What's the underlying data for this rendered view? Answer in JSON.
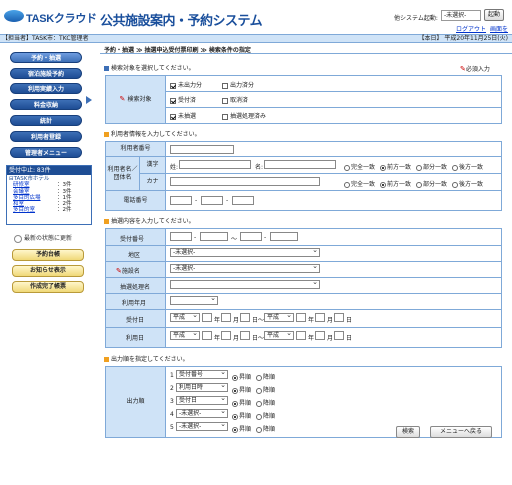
{
  "header": {
    "logo_text": "TASKクラウド",
    "app_title": "公共施設案内・予約システム",
    "system_launch_label": "他システム起動:",
    "system_select_value": "-未選択-",
    "launch_button": "起動",
    "logout_link": "ログアウト",
    "close_link": "画面を閉じる"
  },
  "infobar": {
    "left": "【担当者】TASK市：TKC管理者",
    "right": "【本日】 平成20年11月25日(火)"
  },
  "sidebar": {
    "nav": [
      "予約・抽選",
      "宿泊施設予約",
      "利用実績入力",
      "料金収納",
      "統計",
      "利用者登録",
      "管理者メニュー"
    ],
    "accept_title": "受付中止: 83件",
    "facility_title": "TASK市ホテル",
    "accept_items": [
      {
        "name": "研修室",
        "count": "：3件"
      },
      {
        "name": "会議室",
        "count": "：3件"
      },
      {
        "name": "多目的広場",
        "count": "：1件"
      },
      {
        "name": "和室",
        "count": "：2件"
      },
      {
        "name": "多目的室",
        "count": "：2件"
      }
    ],
    "refresh": "最新の状態に更新",
    "buttons": [
      "予約台帳",
      "お知らせ表示",
      "作成完了帳票"
    ]
  },
  "main": {
    "breadcrumb": "予約・抽選 ≫ 抽選申込受付票印刷 ≫ 検索条件の指定",
    "s1_head": "検索対象を選択してください。",
    "required": "必須入力",
    "s1_label": "検索対象",
    "s1_options": [
      {
        "label": "未出力分",
        "on": true
      },
      {
        "label": "出力済分",
        "on": false
      },
      {
        "label": "受付済",
        "on": true
      },
      {
        "label": "取消済",
        "on": false
      },
      {
        "label": "未抽選",
        "on": true
      },
      {
        "label": "抽選処理済み",
        "on": false
      }
    ],
    "s2_head": "利用者情報を入力してください。",
    "user_no": "利用者番号",
    "user_name": "利用者名／団体名",
    "kanji": "漢字",
    "kana": "カナ",
    "sei": "姓:",
    "mei": "名:",
    "match": [
      "完全一致",
      "前方一致",
      "部分一致",
      "後方一致"
    ],
    "phone": "電話番号",
    "dash": "-",
    "s3_head": "抽選内容を入力してください。",
    "receipt_no": "受付番号",
    "tilde": "～",
    "area": "地区",
    "facility": "施設名",
    "lottery_name": "抽選処理名",
    "use_month": "利用年月",
    "receipt_date": "受付日",
    "use_date": "利用日",
    "unselected": "-未選択-",
    "era": "平成",
    "year": "年",
    "month": "月",
    "day": "日",
    "day_tilde": "日～",
    "s4_head": "出力順を指定してください。",
    "order_label": "出力順",
    "order_rows": [
      {
        "no": "1",
        "value": "受付番号"
      },
      {
        "no": "2",
        "value": "利用日時"
      },
      {
        "no": "3",
        "value": "受付日"
      },
      {
        "no": "4",
        "value": "-未選択-"
      },
      {
        "no": "5",
        "value": "-未選択-"
      }
    ],
    "asc": "昇順",
    "desc": "降順",
    "search_button": "検索",
    "back_button": "メニューへ戻る"
  }
}
